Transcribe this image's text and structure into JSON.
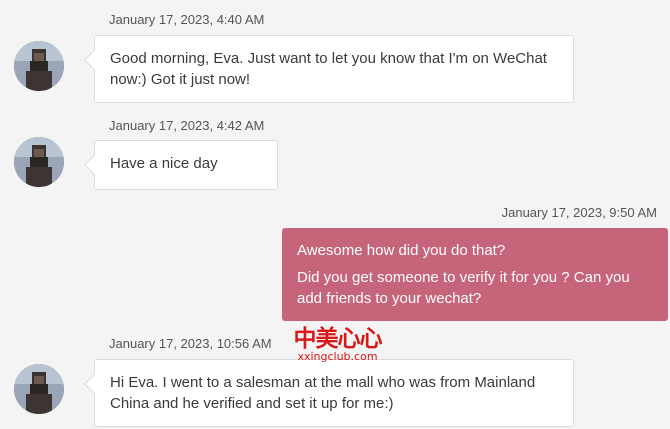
{
  "messages": [
    {
      "direction": "incoming",
      "timestamp": "January 17, 2023, 4:40 AM",
      "lines": [
        "Good morning, Eva. Just want to let you know that I'm on WeChat now:) Got it just now!"
      ]
    },
    {
      "direction": "incoming",
      "timestamp": "January 17, 2023, 4:42 AM",
      "lines": [
        "Have a nice day"
      ]
    },
    {
      "direction": "outgoing",
      "timestamp": "January 17, 2023, 9:50 AM",
      "lines": [
        "Awesome how did you do that?",
        "Did you get someone to verify it for you ?  Can you add friends to your wechat?"
      ]
    },
    {
      "direction": "incoming",
      "timestamp": "January 17, 2023, 10:56 AM",
      "lines": [
        "Hi Eva. I went to a salesman at the mall who was from Mainland China and he verified and set it up for me:)"
      ]
    }
  ],
  "watermark": {
    "title": "中美心心",
    "site": "xxingclub.com"
  },
  "colors": {
    "outgoing_bubble": "#c6657a",
    "incoming_bubble": "#ffffff",
    "background": "#f4f4f4"
  }
}
